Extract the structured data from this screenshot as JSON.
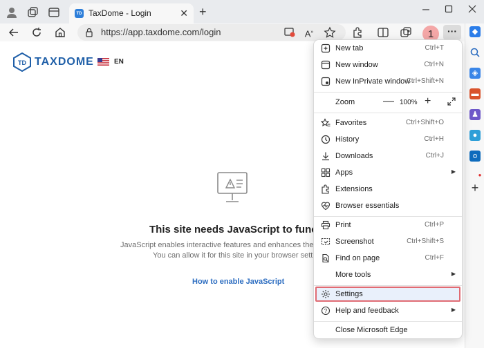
{
  "browser": {
    "tab_title": "TaxDome - Login",
    "tab_favicon_text": "TD",
    "url": "https://app.taxdome.com/login",
    "step_badge": "1",
    "more_label": "···",
    "new_tab_glyph": "+",
    "close_glyph": "✕"
  },
  "page": {
    "logo_initials": "TD",
    "logo_text": "TAXDOME",
    "language": "EN",
    "js_title": "This site needs JavaScript to functio",
    "js_desc_line1": "JavaScript enables interactive features and enhances the user e",
    "js_desc_line2": "You can allow it for this site in your browser settings.",
    "js_link": "How to enable JavaScript"
  },
  "menu": {
    "items": [
      {
        "label": "New tab",
        "shortcut": "Ctrl+T",
        "icon": "new-tab-icon"
      },
      {
        "label": "New window",
        "shortcut": "Ctrl+N",
        "icon": "new-window-icon"
      },
      {
        "label": "New InPrivate window",
        "shortcut": "Ctrl+Shift+N",
        "icon": "inprivate-icon"
      },
      {
        "label": "Zoom",
        "shortcut": "",
        "icon": ""
      },
      {
        "label": "Favorites",
        "shortcut": "Ctrl+Shift+O",
        "icon": "favorites-icon"
      },
      {
        "label": "History",
        "shortcut": "Ctrl+H",
        "icon": "history-icon"
      },
      {
        "label": "Downloads",
        "shortcut": "Ctrl+J",
        "icon": "downloads-icon"
      },
      {
        "label": "Apps",
        "shortcut": "",
        "icon": "apps-icon"
      },
      {
        "label": "Extensions",
        "shortcut": "",
        "icon": "extensions-icon"
      },
      {
        "label": "Browser essentials",
        "shortcut": "",
        "icon": "browser-essentials-icon"
      },
      {
        "label": "Print",
        "shortcut": "Ctrl+P",
        "icon": "print-icon"
      },
      {
        "label": "Screenshot",
        "shortcut": "Ctrl+Shift+S",
        "icon": "screenshot-icon"
      },
      {
        "label": "Find on page",
        "shortcut": "Ctrl+F",
        "icon": "find-icon"
      },
      {
        "label": "More tools",
        "shortcut": "",
        "icon": ""
      },
      {
        "label": "Settings",
        "shortcut": "",
        "icon": "settings-icon"
      },
      {
        "label": "Help and feedback",
        "shortcut": "",
        "icon": "help-icon"
      },
      {
        "label": "Close Microsoft Edge",
        "shortcut": "",
        "icon": ""
      }
    ],
    "zoom_value": "100%",
    "zoom_minus": "—",
    "zoom_plus": "+"
  },
  "colors": {
    "accent": "#1f5fa8",
    "highlight_border": "#e06b73",
    "badge": "#f4a7a7"
  }
}
